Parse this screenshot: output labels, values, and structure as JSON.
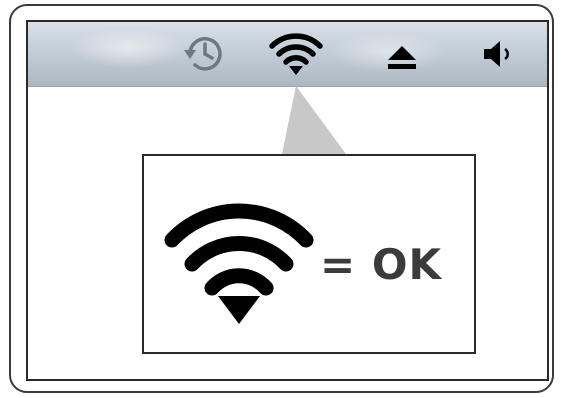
{
  "menubar": {
    "icons": [
      {
        "name": "time-machine-icon"
      },
      {
        "name": "wifi-icon"
      },
      {
        "name": "eject-icon"
      },
      {
        "name": "volume-icon"
      }
    ]
  },
  "callout": {
    "status_text": "= OK"
  },
  "colors": {
    "menubar_top": "#d8e0e8",
    "menubar_bottom": "#aeb8c3",
    "callout_wedge": "#c8c8c8",
    "icon_dark": "#000000",
    "icon_gray": "#6f7780",
    "text": "#3b3b3b"
  }
}
